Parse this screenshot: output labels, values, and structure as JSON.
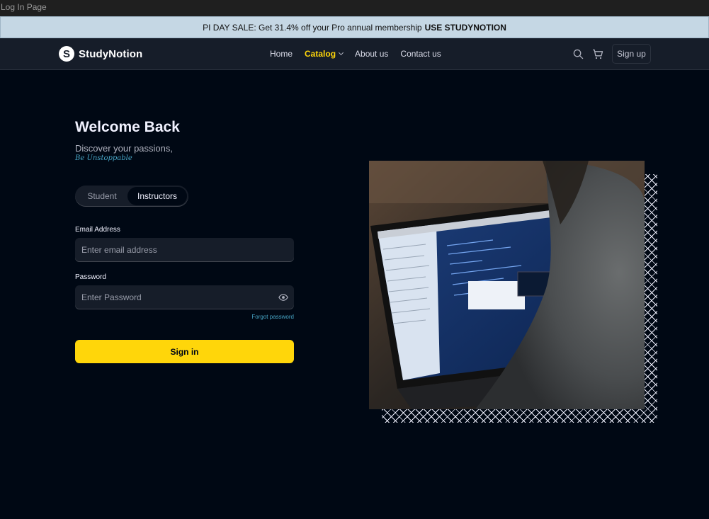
{
  "window": {
    "title": "Log In Page"
  },
  "banner": {
    "text": "PI DAY SALE: Get 31.4% off your Pro annual membership",
    "code": "USE STUDYNOTION"
  },
  "navbar": {
    "brand": "StudyNotion",
    "brand_letter": "S",
    "links": [
      {
        "label": "Home"
      },
      {
        "label": "Catalog",
        "active": true
      },
      {
        "label": "About us"
      },
      {
        "label": "Contact us"
      }
    ],
    "signup_label": "Sign up"
  },
  "login": {
    "title": "Welcome Back",
    "subtitle": "Discover your passions,",
    "tagline": "Be Unstoppable",
    "account_types": [
      "Student",
      "Instructors"
    ],
    "selected_account_type": "Instructors",
    "email_label": "Email Address",
    "email_placeholder": "Enter email address",
    "password_label": "Password",
    "password_placeholder": "Enter Password",
    "forgot_label": "Forgot password",
    "signin_label": "Sign in"
  },
  "colors": {
    "background": "#000814",
    "navbar": "#161D29",
    "accent_yellow": "#FFD60A",
    "link_blue": "#47A5C5",
    "banner": "#C5D7E4"
  },
  "icons": {
    "search": "search-icon",
    "cart": "cart-icon",
    "eye": "eye-icon",
    "chevron": "chevron-down-icon"
  }
}
